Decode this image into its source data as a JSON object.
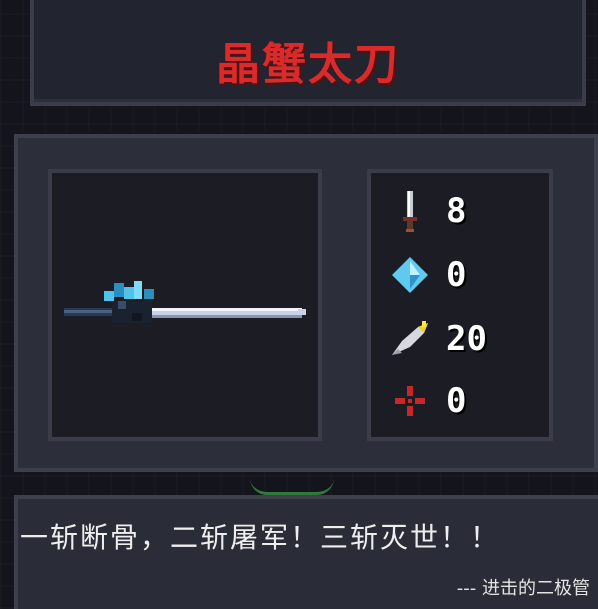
{
  "item": {
    "name": "晶蟹太刀",
    "name_color": "#d92b2b"
  },
  "stats": [
    {
      "icon": "sword-icon",
      "label": "damage",
      "value": "8"
    },
    {
      "icon": "energy-crystal-icon",
      "label": "energy_cost",
      "value": "0"
    },
    {
      "icon": "critical-feather-icon",
      "label": "critical",
      "value": "20"
    },
    {
      "icon": "crosshair-icon",
      "label": "inaccuracy",
      "value": "0"
    }
  ],
  "quote": {
    "text": "一斩断骨，二斩屠军！三斩灭世！！",
    "author": "--- 进击的二极管"
  },
  "weapon": {
    "icon": "crystal-crab-katana-icon",
    "crystal_color": "#4fc3e8",
    "blade_color": "#c9d3e8"
  }
}
